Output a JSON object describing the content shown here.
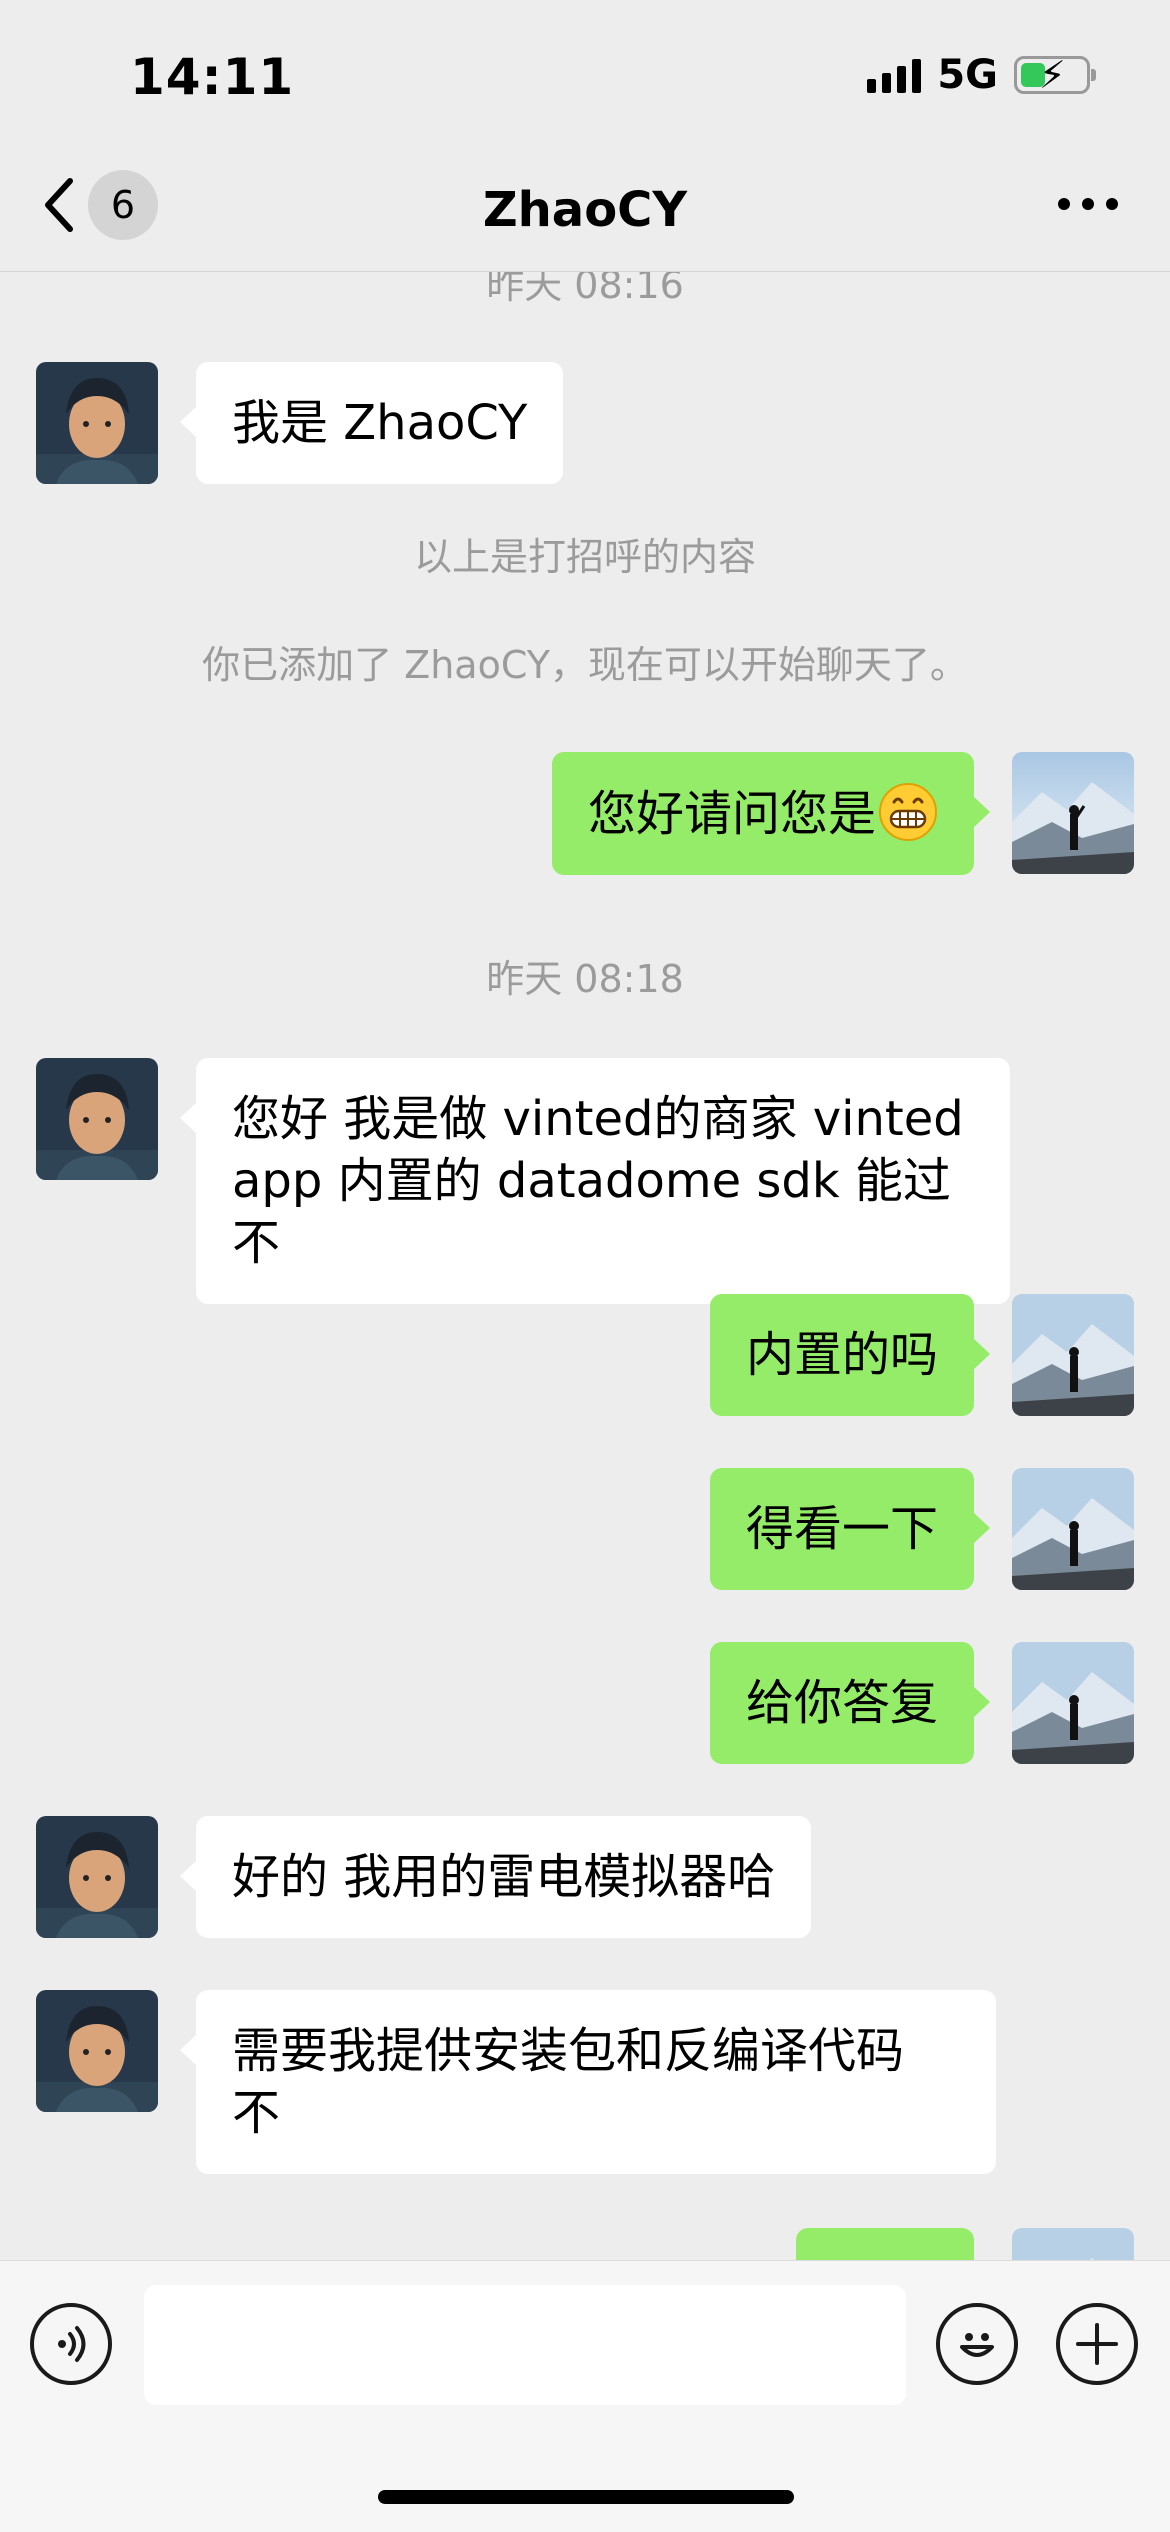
{
  "status_bar": {
    "time": "14:11",
    "network": "5G",
    "battery_level": 0.38
  },
  "nav": {
    "badge": "6",
    "title": "ZhaoCY"
  },
  "messages": {
    "ts1": "昨天 08:16",
    "m1": "我是 ZhaoCY",
    "sys1": "以上是打招呼的内容",
    "sys2": "你已添加了 ZhaoCY，现在可以开始聊天了。",
    "m2": "您好请问您是",
    "ts2": "昨天 08:18",
    "m3_line1": "您好 我是做 vinted的商家 vinted",
    "m3_line2": "app 内置的 datadome sdk 能过不",
    "m4": "内置的吗",
    "m5": "得看一下",
    "m6": "给你答复",
    "m7": "好的 我用的雷电模拟器哈",
    "m8_line1": "需要我提供安装包和反编译代码",
    "m8_line2": "不"
  },
  "icons": {
    "back": "chevron-left-icon",
    "more": "more-dots-icon",
    "voice": "voice-icon",
    "emoji": "emoji-icon",
    "add": "plus-icon"
  },
  "colors": {
    "outgoing_bubble": "#95ec69",
    "incoming_bubble": "#ffffff",
    "background": "#ededed"
  }
}
